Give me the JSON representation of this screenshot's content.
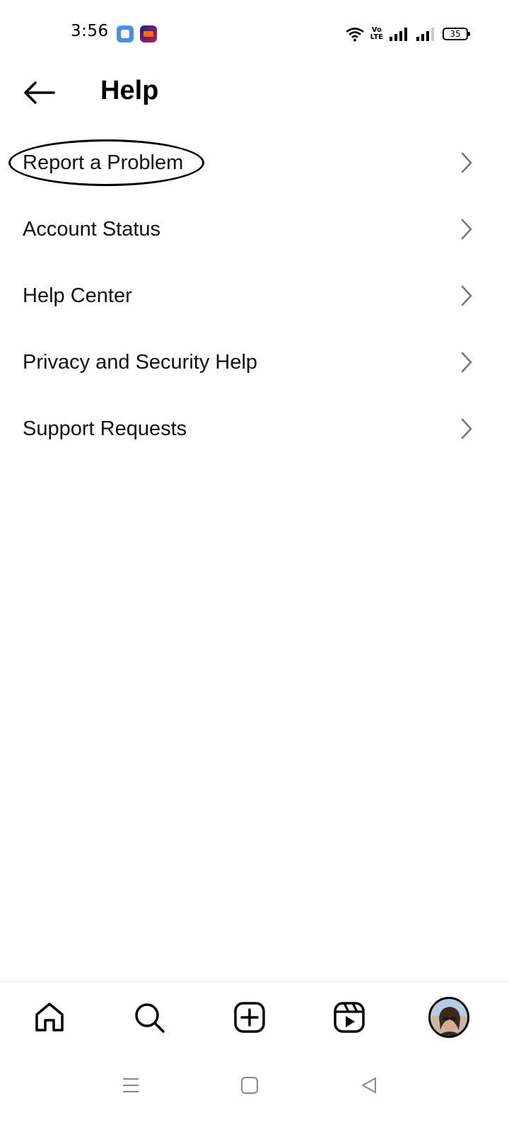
{
  "status_bar": {
    "time": "3:56",
    "app_icons": [
      "notes-app-icon",
      "lazada-app-icon"
    ],
    "volte_label_top": "Vo",
    "volte_label_bottom": "LTE",
    "battery_level": "35"
  },
  "header": {
    "title": "Help",
    "back_icon": "arrow-left-icon"
  },
  "menu": {
    "items": [
      {
        "label": "Report a Problem",
        "highlighted": true
      },
      {
        "label": "Account Status"
      },
      {
        "label": "Help Center"
      },
      {
        "label": "Privacy and Security Help"
      },
      {
        "label": "Support Requests"
      }
    ],
    "chevron_icon": "chevron-right-icon"
  },
  "bottom_nav": {
    "items": [
      "home-icon",
      "search-icon",
      "create-post-icon",
      "reels-icon",
      "profile-avatar"
    ]
  },
  "system_nav": {
    "items": [
      "recent-apps-icon",
      "home-button-icon",
      "back-triangle-icon"
    ]
  },
  "colors": {
    "background": "#ffffff",
    "text": "#000000",
    "chevron": "#777777",
    "divider": "#e6e6e6"
  }
}
